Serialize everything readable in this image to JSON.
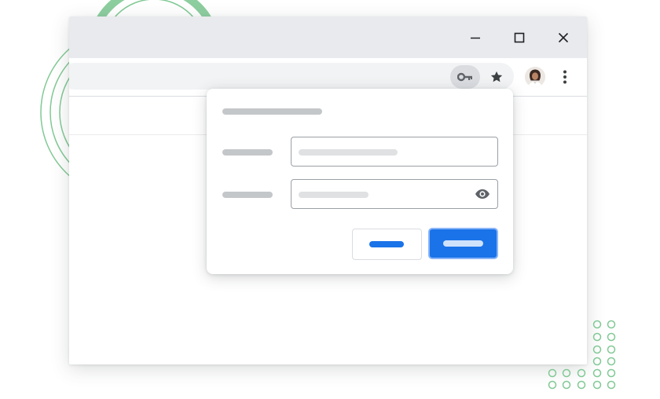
{
  "colors": {
    "accent_blue": "#1a73e8",
    "accent_blue_light": "#8ab4f8",
    "titlebar_gray": "#e8eaed",
    "placeholder_gray": "#c4c7c9",
    "decor_green": "#81c995"
  },
  "window_controls": {
    "minimize_icon": "minimize-icon",
    "maximize_icon": "maximize-icon",
    "close_icon": "close-icon"
  },
  "toolbar": {
    "key_icon": "key-icon",
    "star_icon": "star-icon",
    "avatar_icon": "profile-avatar",
    "menu_icon": "more-vert-icon"
  },
  "dialog": {
    "password_toggle_icon": "eye-icon"
  }
}
